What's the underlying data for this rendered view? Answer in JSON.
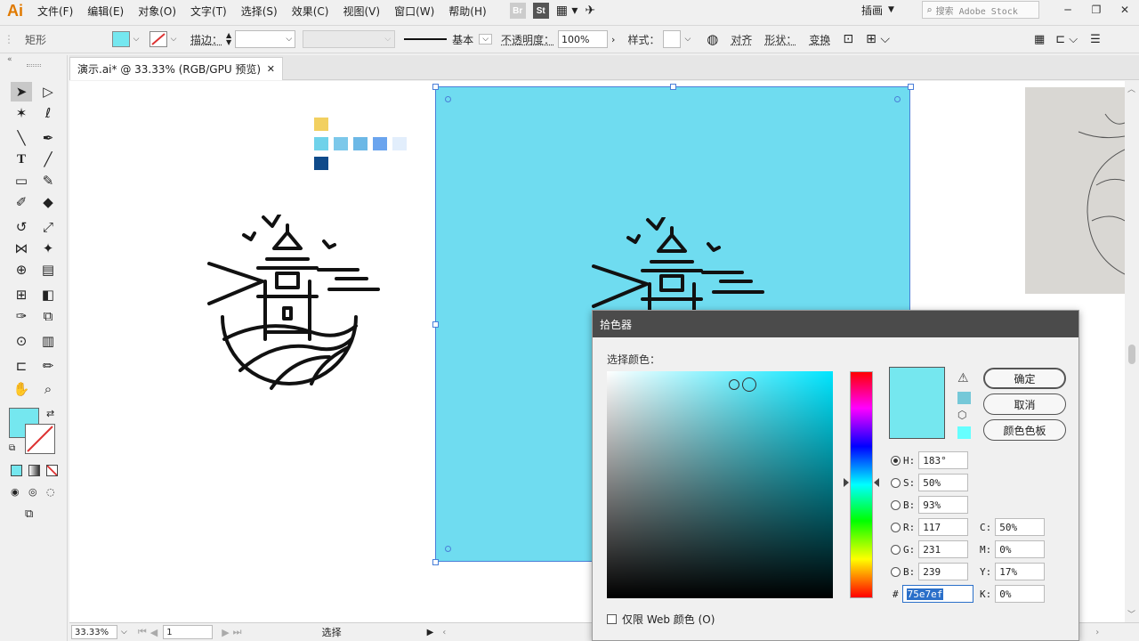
{
  "app": {
    "logo": "Ai"
  },
  "menu": {
    "items": [
      "文件(F)",
      "编辑(E)",
      "对象(O)",
      "文字(T)",
      "选择(S)",
      "效果(C)",
      "视图(V)",
      "窗口(W)",
      "帮助(H)"
    ]
  },
  "bridges": {
    "br": "Br",
    "st": "St"
  },
  "workspace": {
    "label": "插画"
  },
  "stock_search": {
    "placeholder": "搜索 Adobe Stock"
  },
  "window_controls": {
    "minimize": "─",
    "restore": "❐",
    "close": "✕"
  },
  "controlbar": {
    "object_type": "矩形",
    "stroke_label": "描边：",
    "stroke_style": "基本",
    "opacity_label": "不透明度：",
    "opacity_value": "100%",
    "style_label": "样式：",
    "align_label": "对齐",
    "shape_label": "形状：",
    "transform_label": "变换",
    "fill_color": "#75e7ef",
    "stroke_color": "#d33"
  },
  "document": {
    "tab_title": "演示.ai* @ 33.33% (RGB/GPU 预览)",
    "close": "✕"
  },
  "palette": {
    "colors": [
      "#f2d060",
      "#6fd2ea",
      "#7cc8ea",
      "#6cb8e6",
      "#6aa4ee",
      "#e2eefc",
      "#0f4a8a"
    ]
  },
  "artboard": {
    "color": "#6fdcf0"
  },
  "statusbar": {
    "zoom": "33.33%",
    "page": "1",
    "tool": "选择"
  },
  "color_picker": {
    "title": "拾色器",
    "select_label": "选择颜色：",
    "ok": "确定",
    "cancel": "取消",
    "swatches": "颜色色板",
    "hsb": [
      {
        "label": "H:",
        "value": "183°",
        "selected": true
      },
      {
        "label": "S:",
        "value": "50%",
        "selected": false
      },
      {
        "label": "B:",
        "value": "93%",
        "selected": false
      }
    ],
    "rgb": [
      {
        "label": "R:",
        "value": "117"
      },
      {
        "label": "G:",
        "value": "231"
      },
      {
        "label": "B:",
        "value": "239"
      }
    ],
    "cmyk": [
      {
        "label": "C:",
        "value": "50%"
      },
      {
        "label": "M:",
        "value": "0%"
      },
      {
        "label": "Y:",
        "value": "17%"
      },
      {
        "label": "K:",
        "value": "0%"
      }
    ],
    "hex_label": "#",
    "hex_value": "75e7ef",
    "web_only": "仅限 Web 颜色 (O)",
    "current_color": "#75e7ef"
  }
}
